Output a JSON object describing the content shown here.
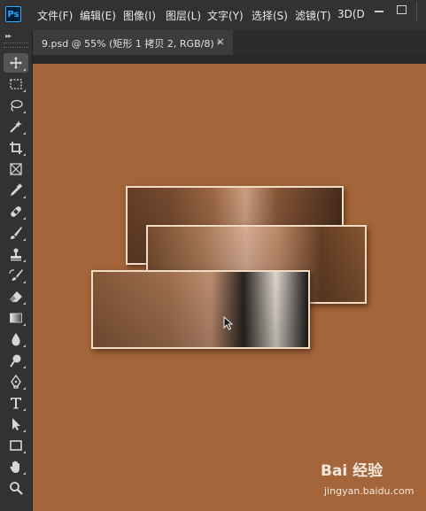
{
  "app": {
    "logo_text": "Ps"
  },
  "menu": [
    {
      "label": "文件(F)"
    },
    {
      "label": "编辑(E)"
    },
    {
      "label": "图像(I)"
    },
    {
      "label": "图层(L)"
    },
    {
      "label": "文字(Y)"
    },
    {
      "label": "选择(S)"
    },
    {
      "label": "滤镜(T)"
    },
    {
      "label": "3D(D"
    }
  ],
  "toolbar": {
    "collapse_glyph": "▸▸",
    "tools": [
      {
        "icon": "move-icon",
        "active": true
      },
      {
        "icon": "marquee-icon"
      },
      {
        "icon": "lasso-icon"
      },
      {
        "icon": "magic-wand-icon"
      },
      {
        "icon": "crop-icon"
      },
      {
        "icon": "frame-icon"
      },
      {
        "icon": "eyedropper-icon"
      },
      {
        "icon": "healing-brush-icon"
      },
      {
        "icon": "brush-icon"
      },
      {
        "icon": "clone-stamp-icon"
      },
      {
        "icon": "history-brush-icon"
      },
      {
        "icon": "eraser-icon"
      },
      {
        "icon": "gradient-icon"
      },
      {
        "icon": "blur-icon"
      },
      {
        "icon": "dodge-icon"
      },
      {
        "icon": "pen-icon"
      },
      {
        "icon": "type-icon"
      },
      {
        "icon": "path-selection-icon"
      },
      {
        "icon": "rectangle-icon"
      },
      {
        "icon": "hand-icon"
      },
      {
        "icon": "zoom-icon"
      }
    ]
  },
  "document": {
    "tab_label": "9.psd @ 55% (矩形 1 拷贝 2, RGB/8) *",
    "close_glyph": "×",
    "canvas_color": "#a4653a"
  },
  "watermark": {
    "logo": "Bai 经验",
    "url": "jingyan.baidu.com"
  }
}
